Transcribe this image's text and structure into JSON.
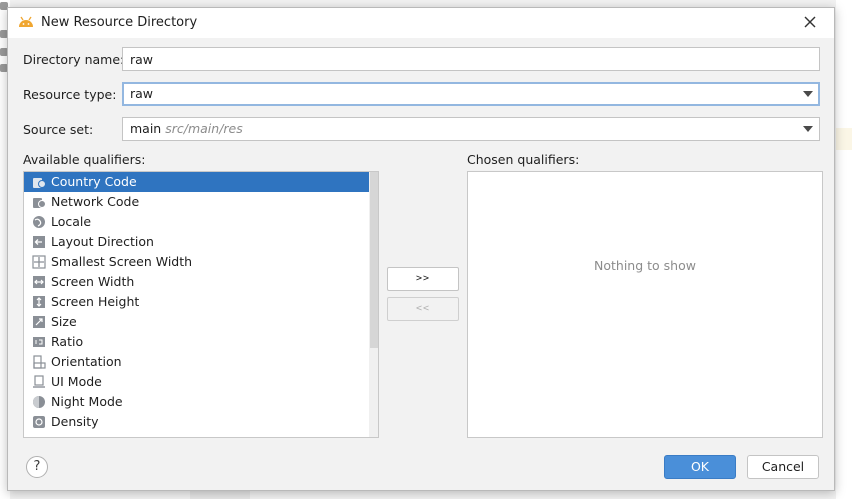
{
  "dialog": {
    "title": "New Resource Directory",
    "app_icon": "android-icon",
    "close_icon": "close-icon"
  },
  "form": {
    "directory_name_label": "Directory name:",
    "directory_name_value": "raw",
    "resource_type_label": "Resource type:",
    "resource_type_value": "raw",
    "source_set_label": "Source set:",
    "source_set_value": "main",
    "source_set_path": "src/main/res"
  },
  "qualifiers": {
    "available_label": "Available qualifiers:",
    "chosen_label": "Chosen qualifiers:",
    "chosen_empty": "Nothing to show",
    "add_button": ">>",
    "remove_button": "<<",
    "items": [
      {
        "label": "Country Code",
        "icon": "country-code-icon"
      },
      {
        "label": "Network Code",
        "icon": "network-code-icon"
      },
      {
        "label": "Locale",
        "icon": "globe-icon"
      },
      {
        "label": "Layout Direction",
        "icon": "layout-direction-icon"
      },
      {
        "label": "Smallest Screen Width",
        "icon": "smallest-width-icon"
      },
      {
        "label": "Screen Width",
        "icon": "screen-width-icon"
      },
      {
        "label": "Screen Height",
        "icon": "screen-height-icon"
      },
      {
        "label": "Size",
        "icon": "size-icon"
      },
      {
        "label": "Ratio",
        "icon": "ratio-icon"
      },
      {
        "label": "Orientation",
        "icon": "orientation-icon"
      },
      {
        "label": "UI Mode",
        "icon": "ui-mode-icon"
      },
      {
        "label": "Night Mode",
        "icon": "night-mode-icon"
      },
      {
        "label": "Density",
        "icon": "density-icon"
      }
    ]
  },
  "footer": {
    "help_label": "?",
    "ok_label": "OK",
    "cancel_label": "Cancel"
  },
  "colors": {
    "selection": "#2f74c0",
    "ok_button": "#4a8fd9",
    "focus_border": "#93b7e0"
  }
}
